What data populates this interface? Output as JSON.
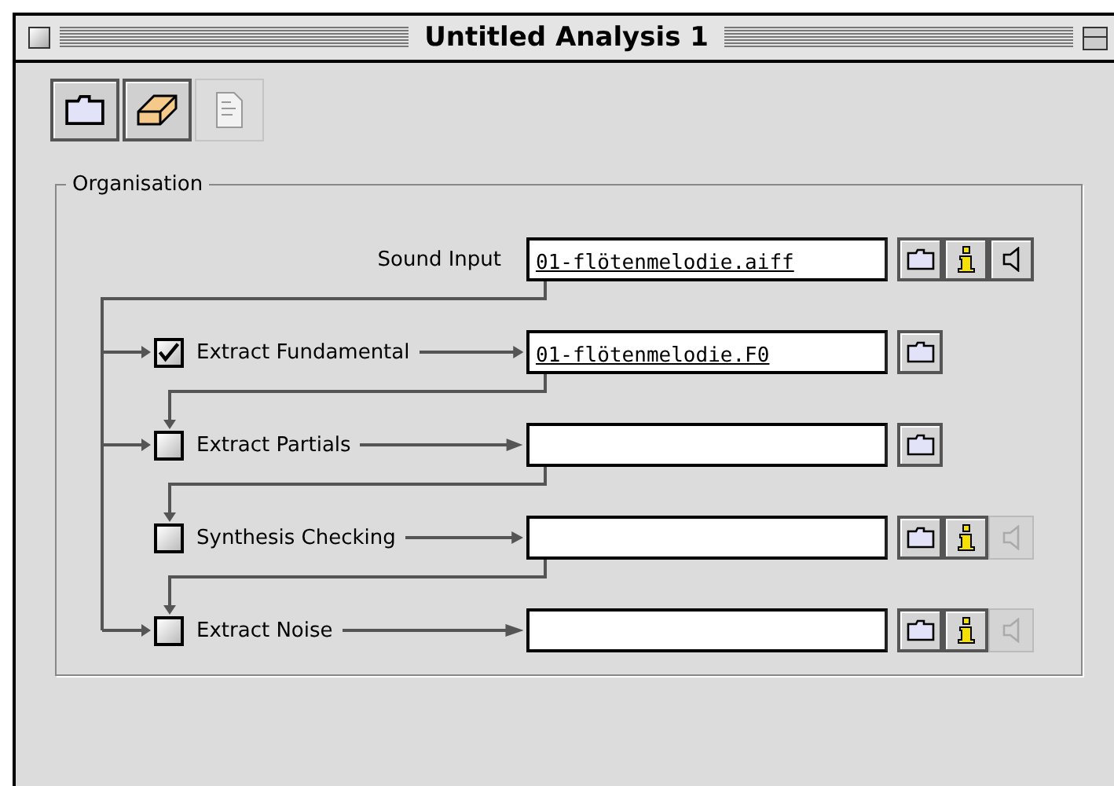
{
  "window": {
    "title": "Untitled Analysis 1"
  },
  "toolbar": [
    {
      "kind": "folder",
      "disabled": false
    },
    {
      "kind": "eraser",
      "disabled": false
    },
    {
      "kind": "document",
      "disabled": true
    }
  ],
  "organisation": {
    "title": "Organisation",
    "rows": [
      {
        "kind": "input",
        "label": "Sound Input",
        "value": "01-flötenmelodie.aiff",
        "buttons": [
          {
            "kind": "folder",
            "disabled": false
          },
          {
            "kind": "info",
            "disabled": false
          },
          {
            "kind": "speaker",
            "disabled": false
          }
        ]
      },
      {
        "kind": "step",
        "label": "Extract Fundamental",
        "checked": true,
        "value": "01-flötenmelodie.F0",
        "buttons": [
          {
            "kind": "folder",
            "disabled": false
          }
        ]
      },
      {
        "kind": "step",
        "label": "Extract Partials",
        "checked": false,
        "buttons": [
          {
            "kind": "folder",
            "disabled": false
          }
        ]
      },
      {
        "kind": "step",
        "label": "Synthesis Checking",
        "checked": false,
        "buttons": [
          {
            "kind": "folder",
            "disabled": false
          },
          {
            "kind": "info",
            "disabled": false
          },
          {
            "kind": "speaker",
            "disabled": true
          }
        ]
      },
      {
        "kind": "step",
        "label": "Extract Noise",
        "checked": false,
        "buttons": [
          {
            "kind": "folder",
            "disabled": false
          },
          {
            "kind": "info",
            "disabled": false
          },
          {
            "kind": "speaker",
            "disabled": true
          }
        ]
      }
    ]
  }
}
